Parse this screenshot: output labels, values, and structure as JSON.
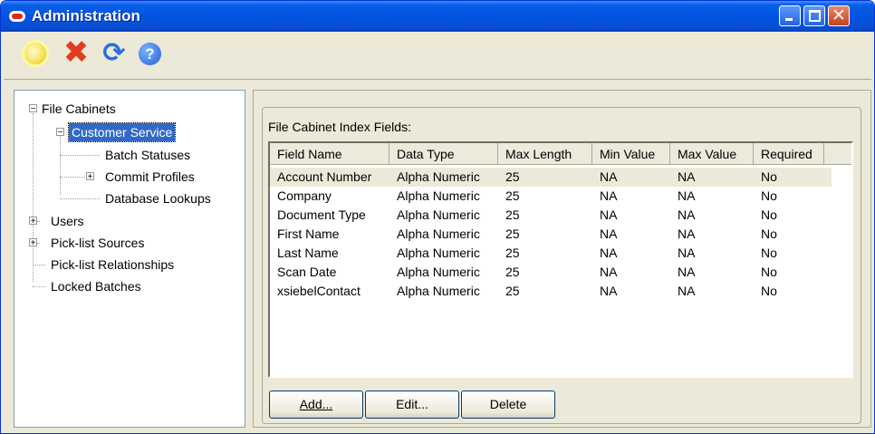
{
  "window": {
    "title": "Administration"
  },
  "toolbar": {
    "icons": [
      "new-icon",
      "delete-icon",
      "refresh-icon",
      "help-icon"
    ],
    "help_glyph": "?"
  },
  "tree": {
    "file_cabinets": "File Cabinets",
    "customer_service": "Customer Service",
    "batch_statuses": "Batch Statuses",
    "commit_profiles": "Commit Profiles",
    "database_lookups": "Database Lookups",
    "users": "Users",
    "picklist_sources": "Pick-list Sources",
    "picklist_relationships": "Pick-list Relationships",
    "locked_batches": "Locked Batches"
  },
  "panel": {
    "group_label": "File Cabinet Index Fields:",
    "columns": [
      "Field Name",
      "Data Type",
      "Max Length",
      "Min Value",
      "Max Value",
      "Required"
    ],
    "rows": [
      [
        "Account Number",
        "Alpha Numeric",
        "25",
        "NA",
        "NA",
        "No"
      ],
      [
        "Company",
        "Alpha Numeric",
        "25",
        "NA",
        "NA",
        "No"
      ],
      [
        "Document Type",
        "Alpha Numeric",
        "25",
        "NA",
        "NA",
        "No"
      ],
      [
        "First Name",
        "Alpha Numeric",
        "25",
        "NA",
        "NA",
        "No"
      ],
      [
        "Last Name",
        "Alpha Numeric",
        "25",
        "NA",
        "NA",
        "No"
      ],
      [
        "Scan Date",
        "Alpha Numeric",
        "25",
        "NA",
        "NA",
        "No"
      ],
      [
        "xsiebelContact",
        "Alpha Numeric",
        "25",
        "NA",
        "NA",
        "No"
      ]
    ]
  },
  "buttons": {
    "add": "Add...",
    "edit": "Edit...",
    "delete": "Delete"
  },
  "colors": {
    "titlebar": "#0054e3",
    "selection": "#316ac5",
    "face": "#ece9d8"
  }
}
